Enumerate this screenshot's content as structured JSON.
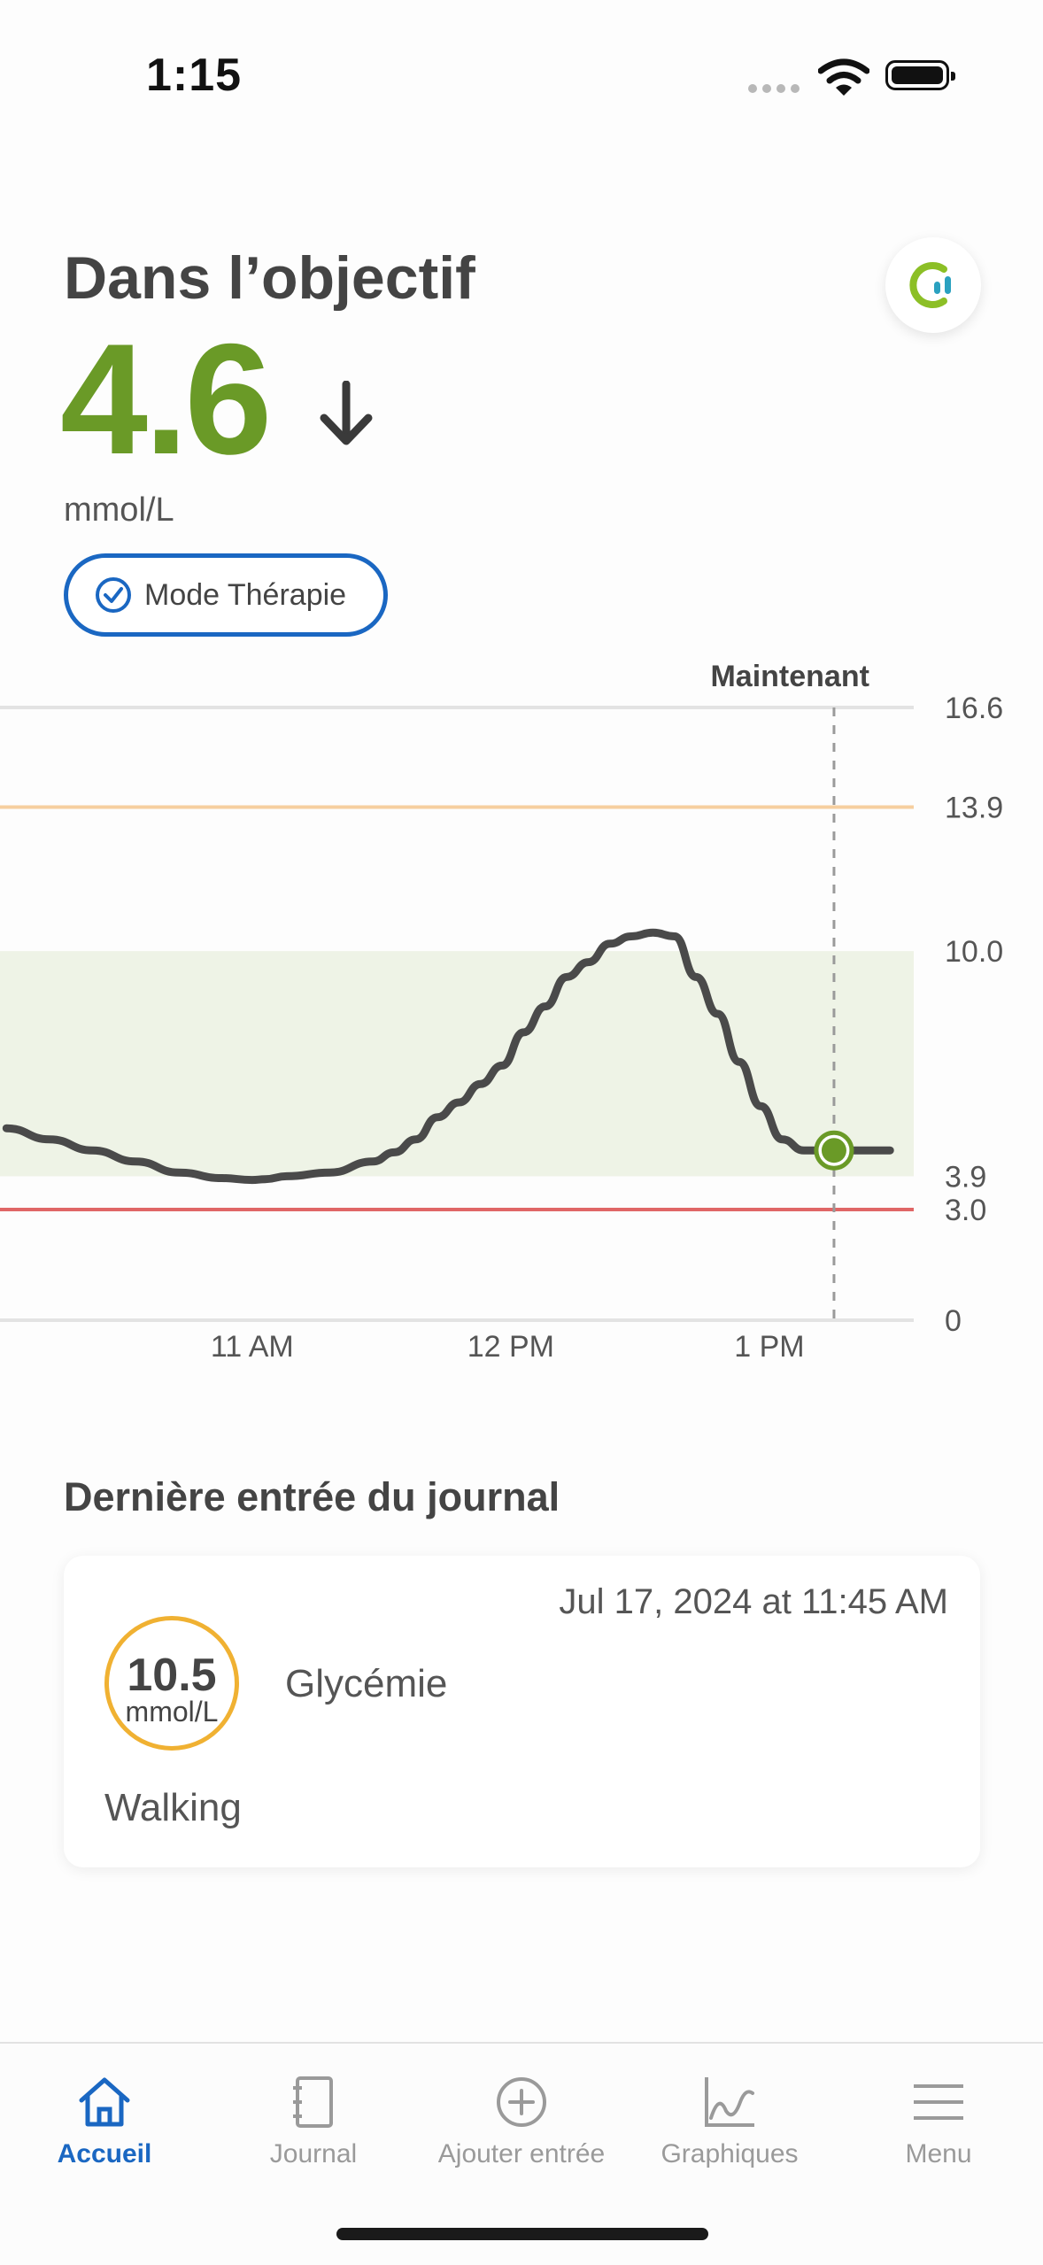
{
  "status_bar": {
    "time": "1:15"
  },
  "header": {
    "status_title": "Dans l’objectif",
    "glucose_value": "4.6",
    "trend": "down-arrow-icon",
    "unit": "mmol/L",
    "mode_label": "Mode Thérapie"
  },
  "chart_data": {
    "type": "line",
    "now_label": "Maintenant",
    "y_ticks": [
      "16.6",
      "13.9",
      "10.0",
      "3.9",
      "3.0",
      "0"
    ],
    "x_ticks": [
      "11 AM",
      "12 PM",
      "1 PM"
    ],
    "ylim": [
      0,
      16.6
    ],
    "target_range": [
      3.9,
      10.0
    ],
    "high_threshold": 13.9,
    "low_threshold": 3.0,
    "series": [
      {
        "x": [
          "10:03",
          "10:13",
          "10:23",
          "10:33",
          "10:43",
          "10:53",
          "11:00",
          "11:03",
          "11:08",
          "11:18",
          "11:28",
          "11:33",
          "11:38",
          "11:43",
          "11:48",
          "11:53",
          "11:58",
          "12:03",
          "12:08",
          "12:13",
          "12:18",
          "12:23",
          "12:28",
          "12:33",
          "12:38",
          "12:43",
          "12:48",
          "12:53",
          "12:58",
          "13:03",
          "13:08",
          "13:13",
          "13:18",
          "13:23",
          "13:28"
        ],
        "values": [
          5.2,
          4.9,
          4.6,
          4.3,
          4.0,
          3.85,
          3.8,
          3.82,
          3.9,
          4.0,
          4.3,
          4.55,
          4.9,
          5.5,
          5.9,
          6.4,
          6.9,
          7.8,
          8.5,
          9.3,
          9.7,
          10.2,
          10.4,
          10.5,
          10.4,
          9.3,
          8.3,
          7.0,
          5.8,
          4.9,
          4.6,
          4.6,
          4.6,
          4.6,
          4.6
        ]
      }
    ],
    "current_point": {
      "x": "13:15",
      "value": 4.6
    },
    "colors": {
      "line": "#4a4a4a",
      "target": "#eef3e6",
      "high": "#f6cf9f",
      "low": "#e06666",
      "point": "#6a9a27"
    }
  },
  "journal": {
    "heading": "Dernière entrée du journal",
    "entry": {
      "date": "Jul 17, 2024 at 11:45 AM",
      "value": "10.5",
      "unit": "mmol/L",
      "type": "Glycémie",
      "note": "Walking",
      "ring_color": "#f0b132"
    }
  },
  "tabs": [
    {
      "label": "Accueil",
      "icon": "home-icon",
      "active": true
    },
    {
      "label": "Journal",
      "icon": "notebook-icon",
      "active": false
    },
    {
      "label": "Ajouter entrée",
      "icon": "add-circle-icon",
      "active": false
    },
    {
      "label": "Graphiques",
      "icon": "line-chart-icon",
      "active": false
    },
    {
      "label": "Menu",
      "icon": "hamburger-menu-icon",
      "active": false
    }
  ],
  "colors": {
    "accent": "#1a67c2",
    "in_range": "#6a9a27"
  }
}
